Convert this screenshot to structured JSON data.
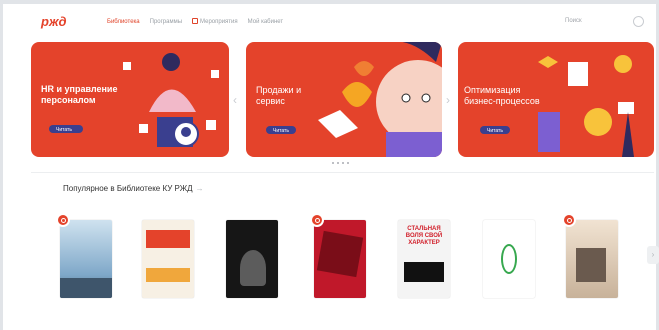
{
  "header": {
    "logo_text": "РЖД",
    "nav_items": [
      {
        "label": "Библиотека",
        "active": true
      },
      {
        "label": "Программы",
        "active": false
      },
      {
        "label": "Мероприятия",
        "active": false,
        "icon": "calendar-icon"
      },
      {
        "label": "Мой кабинет",
        "active": false
      }
    ],
    "search_label": "Поиск",
    "user_icon": "user-icon"
  },
  "banners": [
    {
      "title": "HR и управление персоналом",
      "button": "Читать"
    },
    {
      "title": "Продажи и сервис",
      "button": "Читать"
    },
    {
      "title": "Оптимизация бизнес-процессов",
      "button": "Читать"
    }
  ],
  "section": {
    "title": "Популярное в Библиотеке КУ РЖД",
    "chevron": "→"
  },
  "books": [
    {
      "cover_title": "",
      "caption": "",
      "badge": true
    },
    {
      "cover_title": "",
      "caption": "",
      "badge": false
    },
    {
      "cover_title": "",
      "caption": "",
      "badge": false
    },
    {
      "cover_title": "",
      "caption": "",
      "badge": true
    },
    {
      "cover_title": "СТАЛЬНАЯ ВОЛЯ СВОЙ ХАРАКТЕР",
      "caption": "",
      "badge": false
    },
    {
      "cover_title": "",
      "caption": "",
      "badge": false
    },
    {
      "cover_title": "",
      "caption": "",
      "badge": true
    }
  ],
  "colors": {
    "brand": "#e4432b",
    "button": "#3a3f8f"
  }
}
